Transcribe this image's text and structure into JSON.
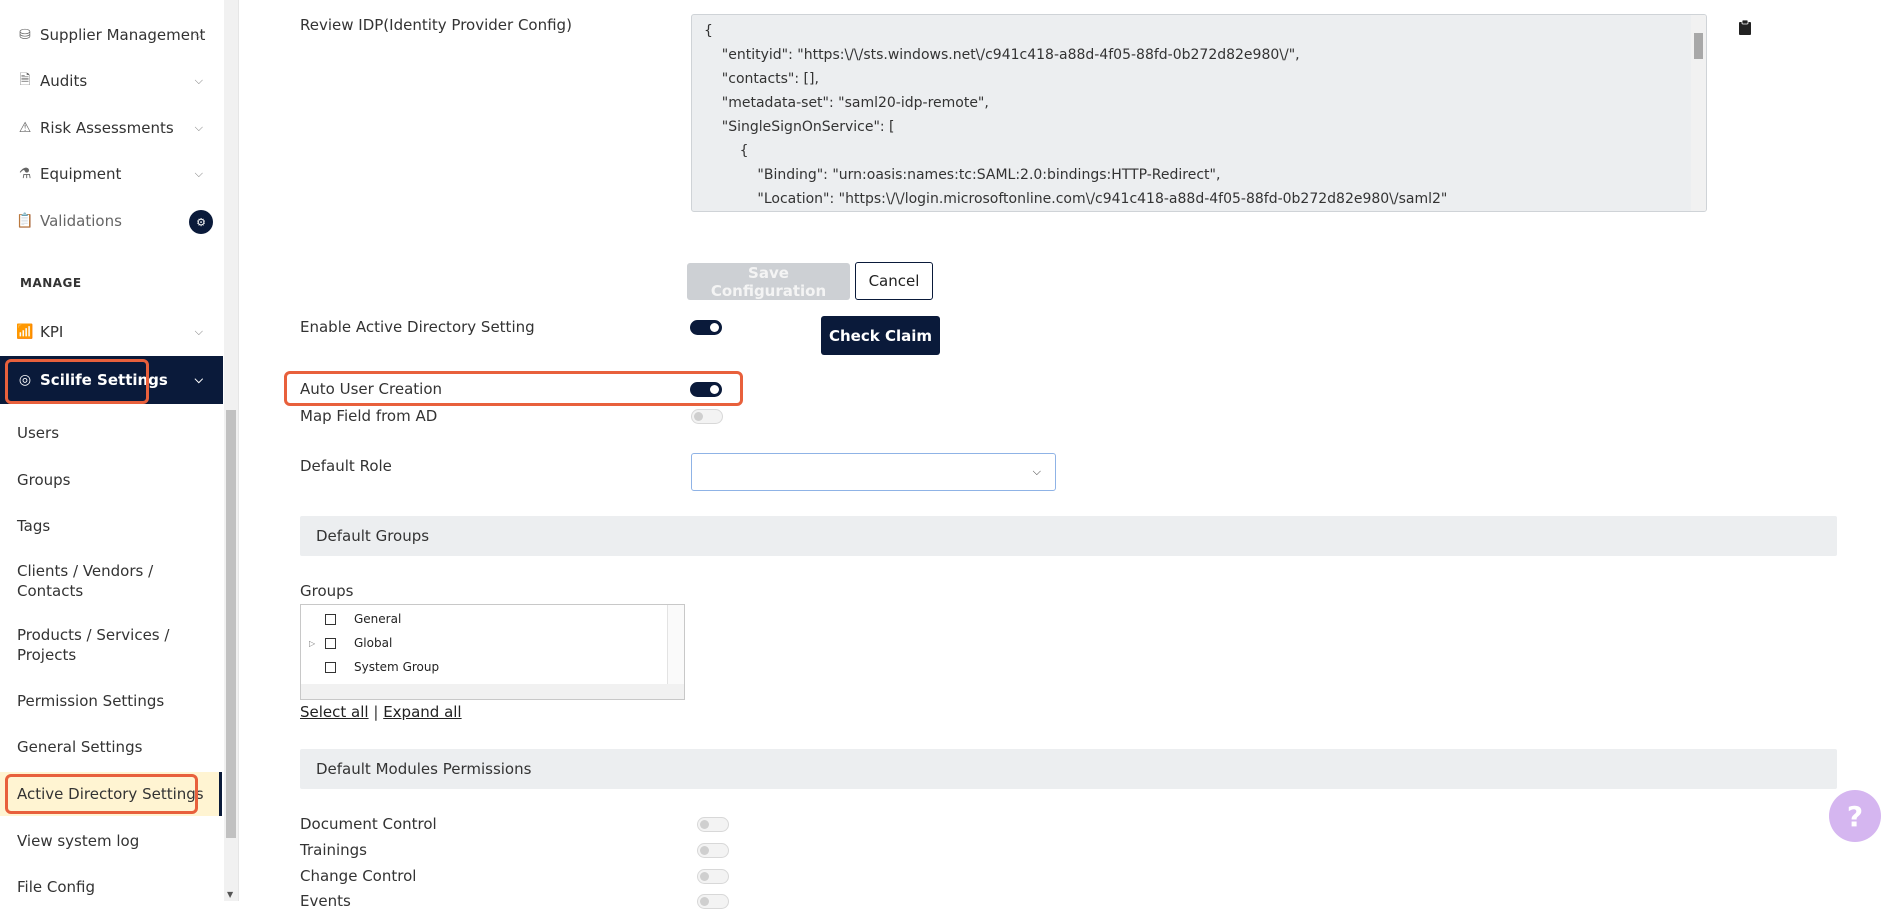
{
  "sidebar": {
    "items": [
      {
        "label": "Supplier Management",
        "icon": "supplier-icon"
      },
      {
        "label": "Audits",
        "icon": "audit-icon"
      },
      {
        "label": "Risk Assessments",
        "icon": "warning-icon"
      },
      {
        "label": "Equipment",
        "icon": "flask-icon"
      },
      {
        "label": "Validations",
        "icon": "clipboard-icon",
        "badge": "⚙"
      }
    ],
    "section_manage": "MANAGE",
    "kpi_label": "KPI",
    "active_label": "Scilife Settings",
    "sub_items": [
      "Users",
      "Groups",
      "Tags",
      "Clients / Vendors / Contacts",
      "Products / Services / Projects",
      "Permission Settings",
      "General Settings",
      "Active Directory Settings",
      "View system log",
      "File Config"
    ]
  },
  "main": {
    "review_idp_label": "Review IDP(Identity Provider Config)",
    "idp_config_lines": [
      "{",
      "    \"entityid\": \"https:\\/\\/sts.windows.net\\/c941c418-a88d-4f05-88fd-0b272d82e980\\/\",",
      "    \"contacts\": [],",
      "    \"metadata-set\": \"saml20-idp-remote\",",
      "    \"SingleSignOnService\": [",
      "        {",
      "            \"Binding\": \"urn:oasis:names:tc:SAML:2.0:bindings:HTTP-Redirect\",",
      "            \"Location\": \"https:\\/\\/login.microsoftonline.com\\/c941c418-a88d-4f05-88fd-0b272d82e980\\/saml2\""
    ],
    "save_label": "Save Configuration",
    "cancel_label": "Cancel",
    "enable_ad_label": "Enable Active Directory Setting",
    "enable_ad_on": true,
    "check_claim_label": "Check Claim",
    "auto_user_label": "Auto User Creation",
    "auto_user_on": true,
    "map_field_label": "Map Field from AD",
    "map_field_on": false,
    "default_role_label": "Default Role",
    "default_role_value": "",
    "default_groups_header": "Default Groups",
    "groups_label": "Groups",
    "groups_tree": [
      {
        "label": "General",
        "expandable": false
      },
      {
        "label": "Global",
        "expandable": true
      },
      {
        "label": "System Group",
        "expandable": false
      }
    ],
    "select_all_label": "Select all",
    "separator": "|",
    "expand_all_label": "Expand all",
    "default_modules_header": "Default Modules Permissions",
    "modules": [
      {
        "label": "Document Control",
        "on": false
      },
      {
        "label": "Trainings",
        "on": false
      },
      {
        "label": "Change Control",
        "on": false
      },
      {
        "label": "Events",
        "on": false
      }
    ]
  },
  "help_label": "?",
  "colors": {
    "primary": "#0a1a3a",
    "highlight": "#e8603c",
    "active_bg": "#fff4d2"
  }
}
